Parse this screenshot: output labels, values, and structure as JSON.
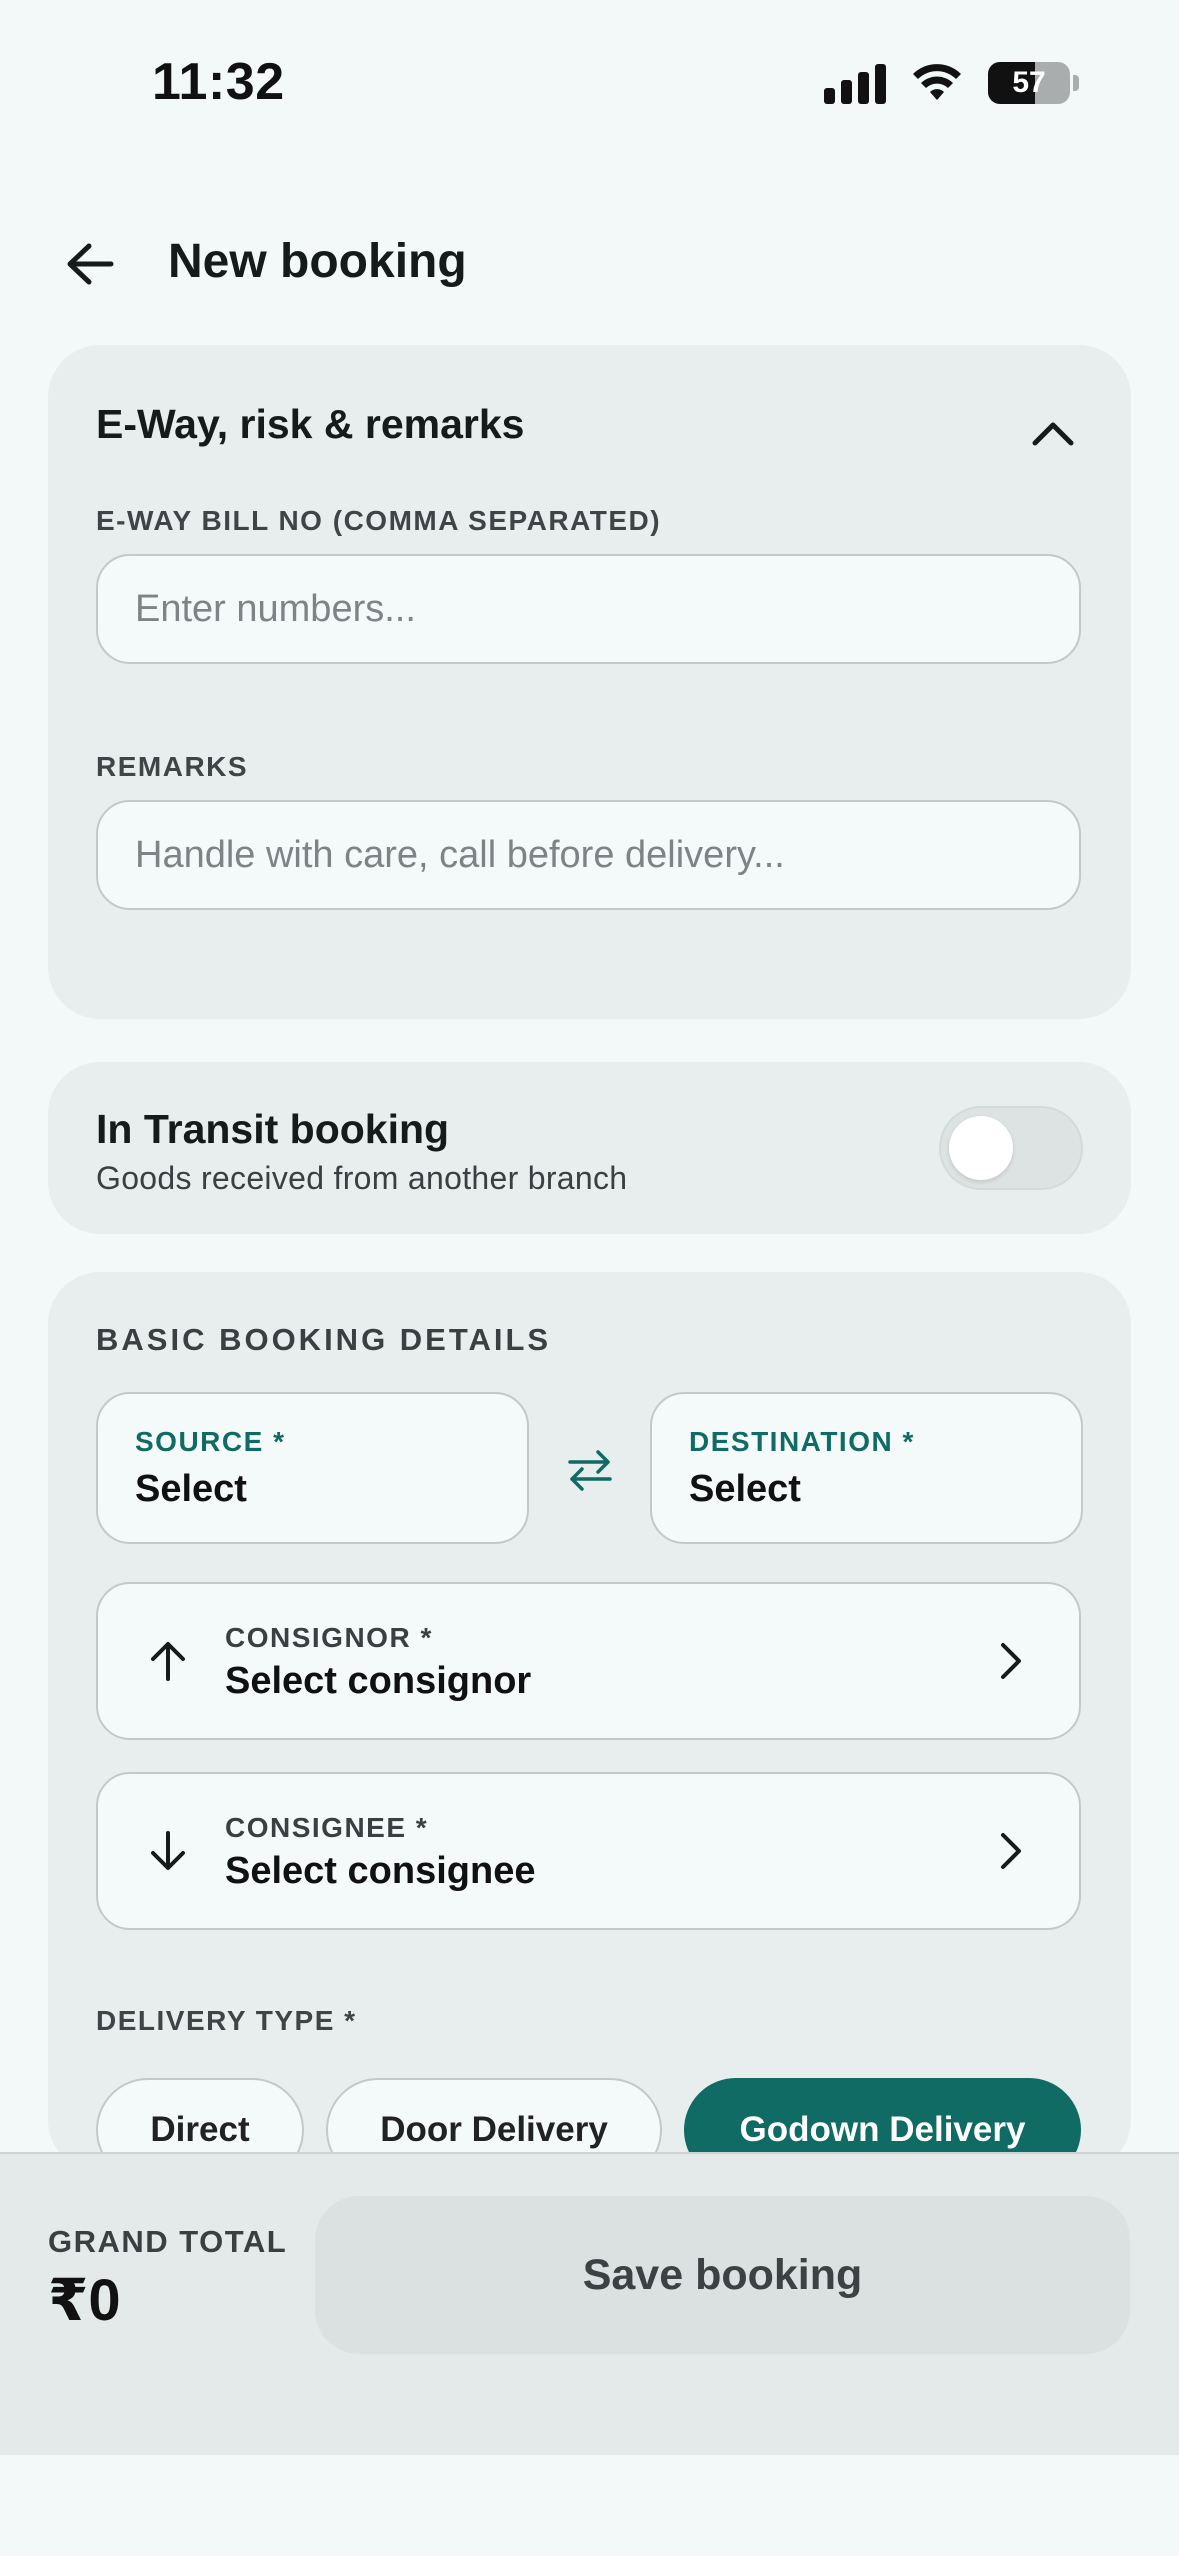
{
  "status_bar": {
    "time": "11:32",
    "battery": "57"
  },
  "header": {
    "title": "New booking"
  },
  "eway_section": {
    "title": "E-Way, risk & remarks",
    "eway_label": "E-WAY BILL NO (COMMA SEPARATED)",
    "eway_placeholder": "Enter numbers...",
    "eway_value": "",
    "remarks_label": "REMARKS",
    "remarks_placeholder": "Handle with care, call before delivery...",
    "remarks_value": ""
  },
  "transit": {
    "title": "In Transit booking",
    "subtitle": "Goods received from another branch",
    "enabled": false
  },
  "basic_details": {
    "title": "BASIC BOOKING DETAILS",
    "source_label": "SOURCE *",
    "source_value": "Select",
    "destination_label": "DESTINATION *",
    "destination_value": "Select",
    "consignor_label": "CONSIGNOR *",
    "consignor_value": "Select consignor",
    "consignee_label": "CONSIGNEE *",
    "consignee_value": "Select consignee",
    "delivery_type_label": "DELIVERY TYPE *",
    "delivery_options": [
      "Direct",
      "Door Delivery",
      "Godown Delivery"
    ],
    "delivery_selected": "Godown Delivery"
  },
  "footer": {
    "total_label": "GRAND TOTAL",
    "total_value": "₹0",
    "save_label": "Save booking"
  },
  "colors": {
    "accent": "#0f6b63",
    "background": "#f3f8f8",
    "card": "#e8eded"
  }
}
